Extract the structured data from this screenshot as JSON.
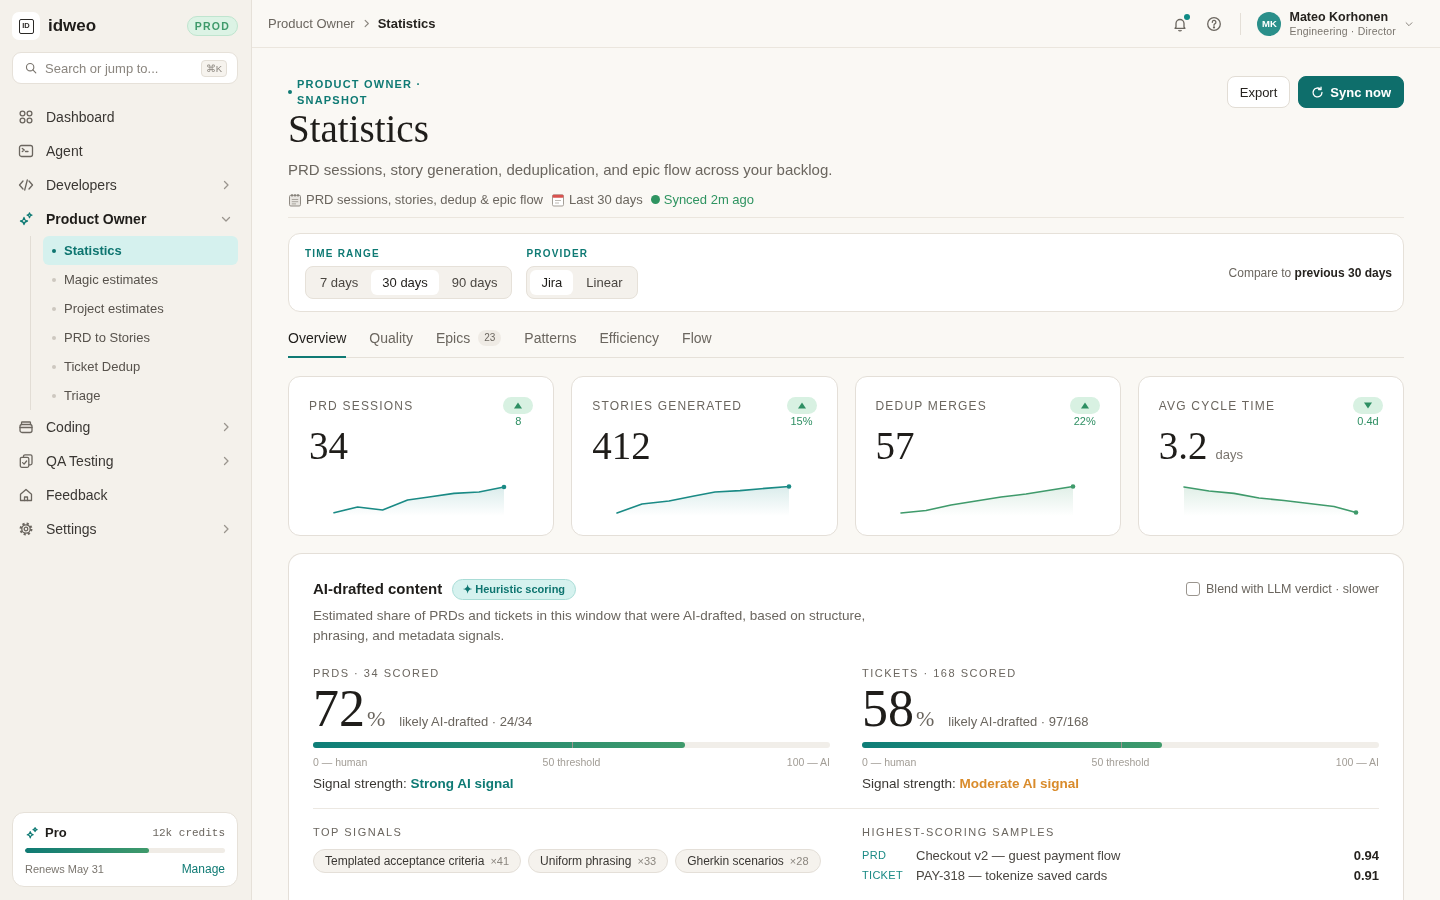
{
  "sidebar": {
    "brand": {
      "logo": "ID",
      "name": "idweo",
      "environment": "PROD"
    },
    "search": {
      "placeholder": "Search or jump to...",
      "shortcut": "⌘K"
    },
    "items": [
      {
        "label": "Dashboard",
        "kind": "link",
        "selected": false
      },
      {
        "label": "Agent",
        "kind": "link",
        "selected": false
      },
      {
        "label": "Developers",
        "kind": "group",
        "selected": false,
        "expanded": false
      },
      {
        "label": "Product Owner",
        "kind": "group",
        "selected": true,
        "expanded": true,
        "children": [
          {
            "label": "Statistics",
            "selected": true
          },
          {
            "label": "Magic estimates",
            "selected": false
          },
          {
            "label": "Project estimates",
            "selected": false
          },
          {
            "label": "PRD to Stories",
            "selected": false
          },
          {
            "label": "Ticket Dedup",
            "selected": false
          },
          {
            "label": "Triage",
            "selected": false
          }
        ]
      },
      {
        "label": "Coding",
        "kind": "group",
        "selected": false,
        "expanded": false
      },
      {
        "label": "QA Testing",
        "kind": "group",
        "selected": false,
        "expanded": false
      },
      {
        "label": "Feedback",
        "kind": "link",
        "selected": false
      },
      {
        "label": "Settings",
        "kind": "group",
        "selected": false,
        "expanded": false
      }
    ],
    "plan": {
      "name": "Pro",
      "credits": "12k credits",
      "level": 0.62,
      "renewal": "Renews May 31",
      "action": "Manage"
    }
  },
  "topbar": {
    "breadcrumb": [
      "Product Owner",
      "Statistics"
    ],
    "notifications": {
      "unread": true
    },
    "user": {
      "initials": "MK",
      "name": "Mateo Korhonen",
      "role": "Engineering · Director"
    }
  },
  "header": {
    "eyebrow": "PRODUCT OWNER · SNAPSHOT",
    "title": "Statistics",
    "subtitle": "PRD sessions, story generation, deduplication, and epic flow across your backlog.",
    "meta": [
      {
        "kind": "scope",
        "text": "PRD sessions, stories, dedup & epic flow"
      },
      {
        "kind": "range",
        "text": "Last 30 days"
      },
      {
        "kind": "status",
        "text": "Synced 2m ago"
      }
    ],
    "actions": [
      {
        "label": "Export",
        "kind": "secondary"
      },
      {
        "label": "Sync now",
        "kind": "primary"
      }
    ]
  },
  "filters": {
    "groups": [
      {
        "label": "TIME RANGE",
        "options": [
          {
            "label": "7 days",
            "selected": false
          },
          {
            "label": "30 days",
            "selected": true
          },
          {
            "label": "90 days",
            "selected": false
          }
        ]
      },
      {
        "label": "PROVIDER",
        "options": [
          {
            "label": "Jira",
            "selected": true
          },
          {
            "label": "Linear",
            "selected": false
          }
        ]
      }
    ],
    "compare": "Compare to **previous 30 days**"
  },
  "tabs": [
    {
      "label": "Overview",
      "selected": true
    },
    {
      "label": "Quality",
      "selected": false
    },
    {
      "label": "Epics",
      "count": "23",
      "selected": false
    },
    {
      "label": "Patterns",
      "selected": false
    },
    {
      "label": "Efficiency",
      "selected": false
    },
    {
      "label": "Flow",
      "selected": false
    }
  ],
  "kpis": [
    {
      "label": "PRD SESSIONS",
      "value": "34",
      "rising": true,
      "delta": "8"
    },
    {
      "label": "STORIES GENERATED",
      "value": "412",
      "rising": true,
      "delta": "15%"
    },
    {
      "label": "DEDUP MERGES",
      "value": "57",
      "rising": true,
      "delta": "22%"
    },
    {
      "label": "AVG CYCLE TIME",
      "value": "3.2",
      "unit": "days",
      "rising": false,
      "delta": "0.4d"
    }
  ],
  "ai_content": {
    "title": "AI-drafted content",
    "badge": "✦ Heuristic scoring",
    "blend": {
      "label": "Blend with LLM verdict · slower",
      "checked": false
    },
    "description": "Estimated share of PRDs and tickets in this window that were AI-drafted, based on structure, phrasing, and metadata signals.",
    "scores": [
      {
        "label": "PRDS · 34 SCORED",
        "value": "72",
        "unit": "%",
        "caption": "likely AI-drafted · 24/34",
        "level": 0.72,
        "scale": [
          "0 — human",
          "50 threshold",
          "100 — AI"
        ],
        "signal_label": "Signal strength:",
        "signal": "Strong AI signal",
        "color": "#0e7a74"
      },
      {
        "label": "TICKETS · 168 SCORED",
        "value": "58",
        "unit": "%",
        "caption": "likely AI-drafted · 97/168",
        "level": 0.58,
        "scale": [
          "0 — human",
          "50 threshold",
          "100 — AI"
        ],
        "signal_label": "Signal strength:",
        "signal": "Moderate AI signal",
        "color": "#d98b2b"
      }
    ],
    "signals": {
      "label": "TOP SIGNALS",
      "items": [
        {
          "label": "Templated acceptance criteria",
          "count": "×41"
        },
        {
          "label": "Uniform phrasing",
          "count": "×33"
        },
        {
          "label": "Gherkin scenarios",
          "count": "×28"
        }
      ]
    },
    "samples": {
      "label": "HIGHEST-SCORING SAMPLES",
      "rows": [
        {
          "type": "PRD",
          "title": "Checkout v2 — guest payment flow",
          "score": "0.94"
        },
        {
          "type": "TICKET",
          "title": "PAY-318 — tokenize saved cards",
          "score": "0.91"
        }
      ]
    }
  }
}
